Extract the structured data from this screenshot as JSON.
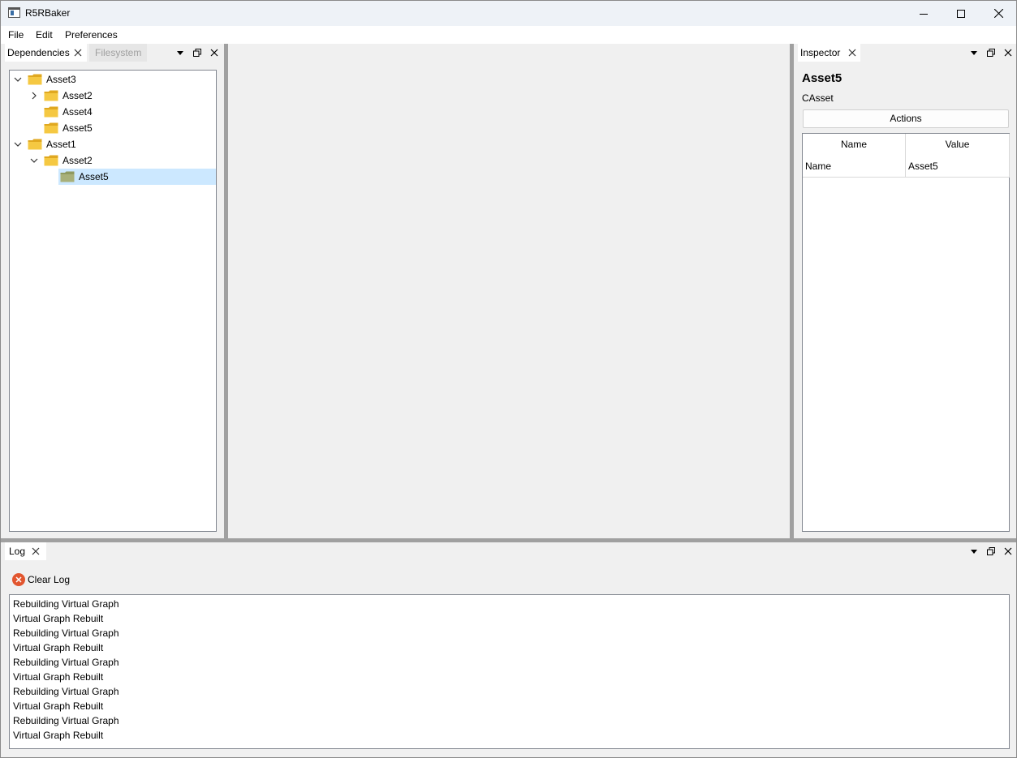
{
  "window": {
    "title": "R5RBaker"
  },
  "menubar": {
    "items": [
      "File",
      "Edit",
      "Preferences"
    ]
  },
  "left_dock": {
    "tabs": [
      {
        "label": "Dependencies",
        "active": true
      },
      {
        "label": "Filesystem",
        "active": false
      }
    ],
    "tree": [
      {
        "label": "Asset3",
        "depth": 0,
        "expander": "expanded",
        "selected": false
      },
      {
        "label": "Asset2",
        "depth": 1,
        "expander": "collapsed",
        "selected": false
      },
      {
        "label": "Asset4",
        "depth": 1,
        "expander": "none",
        "selected": false
      },
      {
        "label": "Asset5",
        "depth": 1,
        "expander": "none",
        "selected": false
      },
      {
        "label": "Asset1",
        "depth": 0,
        "expander": "expanded",
        "selected": false
      },
      {
        "label": "Asset2",
        "depth": 1,
        "expander": "expanded",
        "selected": false
      },
      {
        "label": "Asset5",
        "depth": 2,
        "expander": "none",
        "selected": true
      }
    ]
  },
  "inspector": {
    "tab_label": "Inspector",
    "asset_name": "Asset5",
    "asset_type": "CAsset",
    "actions_label": "Actions",
    "table": {
      "headers": [
        "Name",
        "Value"
      ],
      "rows": [
        [
          "Name",
          "Asset5"
        ]
      ]
    }
  },
  "log_dock": {
    "tab_label": "Log",
    "clear_label": "Clear Log",
    "lines": [
      "Rebuilding Virtual Graph",
      "Virtual Graph Rebuilt",
      "Rebuilding Virtual Graph",
      "Virtual Graph Rebuilt",
      "Rebuilding Virtual Graph",
      "Virtual Graph Rebuilt",
      "Rebuilding Virtual Graph",
      "Virtual Graph Rebuilt",
      "Rebuilding Virtual Graph",
      "Virtual Graph Rebuilt"
    ]
  },
  "colors": {
    "selection": "#cce8ff",
    "folder": "#f5c842",
    "folder_selected": "#a8b07a",
    "clear_icon": "#e2562f"
  }
}
